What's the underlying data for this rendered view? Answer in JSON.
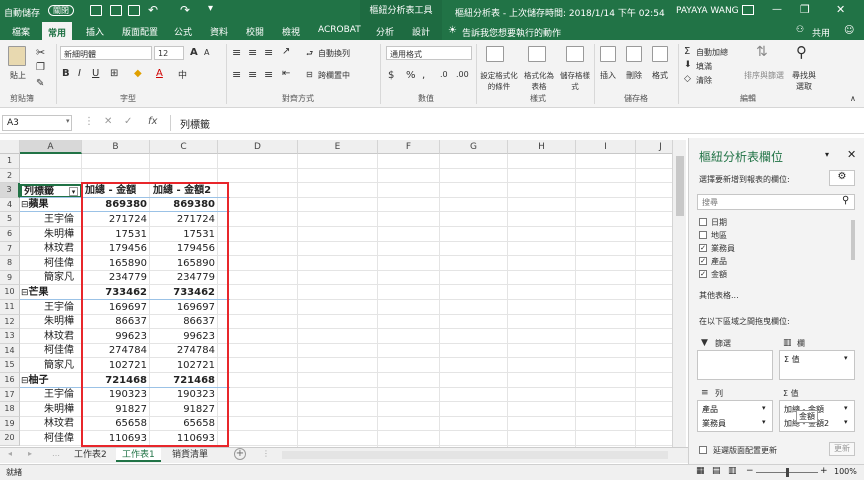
{
  "titlebar": {
    "autosave": "自動儲存",
    "autosave_state": "關閉",
    "context_tools": "樞紐分析表工具",
    "doc_title": "樞紐分析表 - 上次儲存時間: 2018/1/14 下午 02:54",
    "user": "PAYAYA WANG",
    "minimize": "—",
    "restore": "❐",
    "close": "✕"
  },
  "tabs": [
    "檔案",
    "常用",
    "插入",
    "版面配置",
    "公式",
    "資料",
    "校閱",
    "檢視",
    "ACROBAT",
    "分析",
    "設計"
  ],
  "tell_me": "告訴我您想要執行的動作",
  "share": "共用",
  "ribbon": {
    "paste": "貼上",
    "clipboard": "剪貼簿",
    "font_name": "新細明體",
    "font_size": "12",
    "font_group": "字型",
    "bold": "B",
    "italic": "I",
    "underline": "U",
    "grow": "A",
    "shrink": "A",
    "wrap": "自動換列",
    "merge": "跨欄置中",
    "align_group": "對齊方式",
    "number_format": "通用格式",
    "currency": "$",
    "percent": "%",
    "comma": ",",
    "number_group": "數值",
    "cond_format": "設定格式化的條件",
    "format_table": "格式化為表格",
    "cell_styles": "儲存格樣式",
    "styles_group": "樣式",
    "insert": "插入",
    "delete": "刪除",
    "format": "格式",
    "cells_group": "儲存格",
    "autosum": "自動加總",
    "fill": "填滿",
    "clear": "清除",
    "sort_filter": "排序與篩選",
    "find_select": "尋找與選取",
    "editing_group": "編輯"
  },
  "formula": {
    "namebox": "A3",
    "cancel": "✕",
    "enter": "✓",
    "fx": "fx",
    "content": "列標籤"
  },
  "grid": {
    "columns": [
      "A",
      "B",
      "C",
      "D",
      "E",
      "F",
      "G",
      "H",
      "I",
      "J"
    ],
    "rows": [
      {
        "n": "1",
        "a": "",
        "b": "",
        "c": ""
      },
      {
        "n": "2",
        "a": "",
        "b": "",
        "c": ""
      },
      {
        "n": "3",
        "a": "列標籤",
        "b": "加總 - 金額",
        "c": "加總 - 金額2"
      },
      {
        "n": "4",
        "a": "蘋果",
        "b": "869380",
        "c": "869380"
      },
      {
        "n": "5",
        "a": "王宇倫",
        "b": "271724",
        "c": "271724"
      },
      {
        "n": "6",
        "a": "朱明樺",
        "b": "17531",
        "c": "17531"
      },
      {
        "n": "7",
        "a": "林玟君",
        "b": "179456",
        "c": "179456"
      },
      {
        "n": "8",
        "a": "柯佳偉",
        "b": "165890",
        "c": "165890"
      },
      {
        "n": "9",
        "a": "簡家凡",
        "b": "234779",
        "c": "234779"
      },
      {
        "n": "10",
        "a": "芒果",
        "b": "733462",
        "c": "733462"
      },
      {
        "n": "11",
        "a": "王宇倫",
        "b": "169697",
        "c": "169697"
      },
      {
        "n": "12",
        "a": "朱明樺",
        "b": "86637",
        "c": "86637"
      },
      {
        "n": "13",
        "a": "林玟君",
        "b": "99623",
        "c": "99623"
      },
      {
        "n": "14",
        "a": "柯佳偉",
        "b": "274784",
        "c": "274784"
      },
      {
        "n": "15",
        "a": "簡家凡",
        "b": "102721",
        "c": "102721"
      },
      {
        "n": "16",
        "a": "柚子",
        "b": "721468",
        "c": "721468"
      },
      {
        "n": "17",
        "a": "王宇倫",
        "b": "190323",
        "c": "190323"
      },
      {
        "n": "18",
        "a": "朱明樺",
        "b": "91827",
        "c": "91827"
      },
      {
        "n": "19",
        "a": "林玟君",
        "b": "65658",
        "c": "65658"
      },
      {
        "n": "20",
        "a": "柯佳偉",
        "b": "110693",
        "c": "110693"
      }
    ],
    "group_rows": [
      "4",
      "10",
      "16"
    ],
    "collapse_glyph": "⊟",
    "filter_glyph": "▾"
  },
  "highlight_color": "#e8262b",
  "accent": "#217346",
  "pane": {
    "title": "樞紐分析表欄位",
    "subtitle": "選擇要新增到報表的欄位:",
    "search_placeholder": "搜尋",
    "fields": [
      {
        "label": "日期",
        "checked": false
      },
      {
        "label": "地區",
        "checked": false
      },
      {
        "label": "業務員",
        "checked": true
      },
      {
        "label": "產品",
        "checked": true
      },
      {
        "label": "金額",
        "checked": true
      }
    ],
    "more_tables": "其他表格...",
    "drag_hint": "在以下區域之間拖曳欄位:",
    "filters_label": "篩選",
    "columns_label": "欄",
    "columns_items": [
      "Σ 值"
    ],
    "rows_label": "列",
    "rows_items": [
      "產品",
      "業務員"
    ],
    "values_label": "Σ 值",
    "values_items": [
      "加總 - 金額",
      "加總 - 金額2"
    ],
    "defer_label": "延遲版面配置更新",
    "update_btn": "更新",
    "drag_tooltip": "金額"
  },
  "sheets": [
    "工作表2",
    "工作表1",
    "销貨清單"
  ],
  "active_sheet": "工作表1",
  "add_sheet": "+",
  "status": {
    "ready": "就緒",
    "zoom": "100%"
  }
}
